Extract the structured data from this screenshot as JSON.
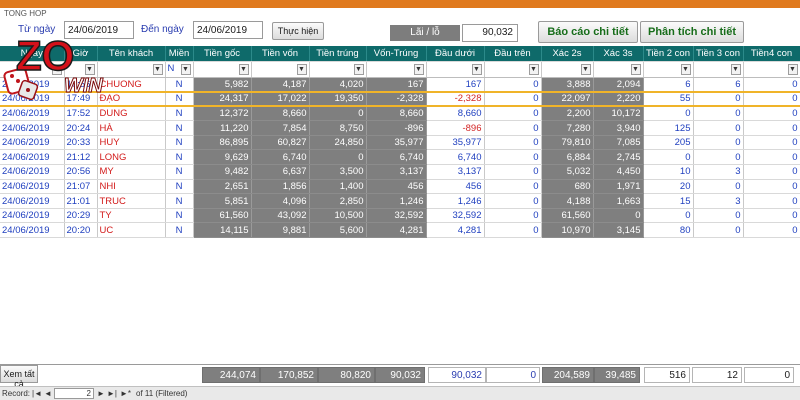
{
  "window": {
    "title": "TONG HOP"
  },
  "toolbar": {
    "from_label": "Từ ngày",
    "from_value": "24/06/2019",
    "to_label": "Đến ngày",
    "to_value": "24/06/2019",
    "run_button": "Thực hiện",
    "lailo_label": "Lãi / lỗ",
    "lailo_value": "90,032",
    "report_detail_button": "Báo cáo chi tiết",
    "analysis_detail_button": "Phân tích chi tiết"
  },
  "logo": {
    "text_zo": "ZO",
    "text_win": "WIN",
    "icon": "dice-icon"
  },
  "grid": {
    "headers": [
      "Ngày",
      "Giờ",
      "Tên khách",
      "Miền",
      "Tiền gốc",
      "Tiền vốn",
      "Tiền trúng",
      "Vốn-Trúng",
      "Đầu dưới",
      "Đầu trên",
      "Xác 2s",
      "Xác 3s",
      "Tiền 2 con",
      "Tiền 3 con",
      "Tiền4 con"
    ],
    "filter_region": "N",
    "rows": [
      [
        "24/06/2019",
        "17:56",
        "CHUONG",
        "N",
        "5,982",
        "4,187",
        "4,020",
        "167",
        "167",
        "0",
        "3,888",
        "2,094",
        "6",
        "6",
        "0"
      ],
      [
        "24/06/2019",
        "17:49",
        "ĐẠO",
        "N",
        "24,317",
        "17,022",
        "19,350",
        "-2,328",
        "-2,328",
        "0",
        "22,097",
        "2,220",
        "55",
        "0",
        "0"
      ],
      [
        "24/06/2019",
        "17:52",
        "DUNG",
        "N",
        "12,372",
        "8,660",
        "0",
        "8,660",
        "8,660",
        "0",
        "2,200",
        "10,172",
        "0",
        "0",
        "0"
      ],
      [
        "24/06/2019",
        "20:24",
        "HÀ",
        "N",
        "11,220",
        "7,854",
        "8,750",
        "-896",
        "-896",
        "0",
        "7,280",
        "3,940",
        "125",
        "0",
        "0"
      ],
      [
        "24/06/2019",
        "20:33",
        "HUY",
        "N",
        "86,895",
        "60,827",
        "24,850",
        "35,977",
        "35,977",
        "0",
        "79,810",
        "7,085",
        "205",
        "0",
        "0"
      ],
      [
        "24/06/2019",
        "21:12",
        "LONG",
        "N",
        "9,629",
        "6,740",
        "0",
        "6,740",
        "6,740",
        "0",
        "6,884",
        "2,745",
        "0",
        "0",
        "0"
      ],
      [
        "24/06/2019",
        "20:56",
        "MY",
        "N",
        "9,482",
        "6,637",
        "3,500",
        "3,137",
        "3,137",
        "0",
        "5,032",
        "4,450",
        "10",
        "3",
        "0"
      ],
      [
        "24/06/2019",
        "21:07",
        "NHI",
        "N",
        "2,651",
        "1,856",
        "1,400",
        "456",
        "456",
        "0",
        "680",
        "1,971",
        "20",
        "0",
        "0"
      ],
      [
        "24/06/2019",
        "21:01",
        "TRUC",
        "N",
        "5,851",
        "4,096",
        "2,850",
        "1,246",
        "1,246",
        "0",
        "4,188",
        "1,663",
        "15",
        "3",
        "0"
      ],
      [
        "24/06/2019",
        "20:29",
        "TY",
        "N",
        "61,560",
        "43,092",
        "10,500",
        "32,592",
        "32,592",
        "0",
        "61,560",
        "0",
        "0",
        "0",
        "0"
      ],
      [
        "24/06/2019",
        "20:20",
        "UC",
        "N",
        "14,115",
        "9,881",
        "5,600",
        "4,281",
        "4,281",
        "0",
        "10,970",
        "3,145",
        "80",
        "0",
        "0"
      ]
    ],
    "selected_row": 1
  },
  "totals": {
    "show_all_button": "Xem tất cả",
    "tien_goc": "244,074",
    "tien_von": "170,852",
    "tien_trung": "80,820",
    "von_trung": "90,032",
    "dau_duoi": "90,032",
    "dau_tren": "0",
    "xac_2s": "204,589",
    "xac_3s": "39,485",
    "tien_2con": "516",
    "tien_3con": "12",
    "tien_4con": "0"
  },
  "navbar": {
    "record_label": "Record:",
    "current": "2",
    "of_text": "of 11 (Filtered)"
  },
  "colors": {
    "header_bg": "#0e6a6a",
    "gray_col": "#7f7f7f",
    "name_red": "#d21a1a",
    "accent_orange": "#e07a1e",
    "button_green_text": "#176d1a"
  }
}
